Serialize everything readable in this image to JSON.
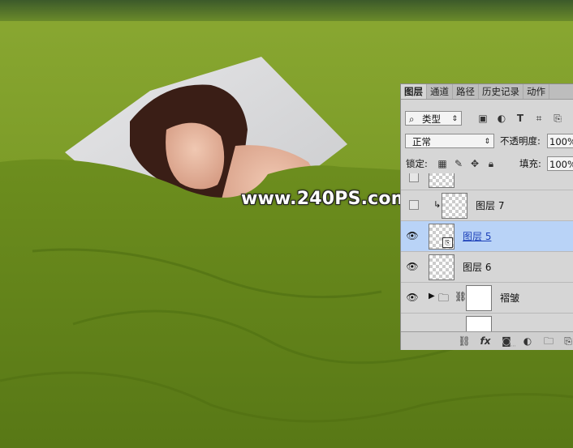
{
  "watermark": "www.240PS.com",
  "panel": {
    "tabs": [
      "图层",
      "通道",
      "路径",
      "历史记录",
      "动作"
    ],
    "filter": {
      "icon": "search-icon",
      "label": "类型"
    },
    "blend_mode": "正常",
    "opacity_label": "不透明度:",
    "opacity_value": "100%",
    "lock_label": "锁定:",
    "fill_label": "填充:",
    "fill_value": "100%",
    "layers": [
      {
        "name": "图层 7",
        "visible": false,
        "clipped": true,
        "selected": false
      },
      {
        "name": "图层 5",
        "visible": true,
        "smart_object": true,
        "selected": true
      },
      {
        "name": "图层 6",
        "visible": true,
        "selected": false
      },
      {
        "name": "褶皱",
        "visible": true,
        "group": true,
        "mask": true,
        "selected": false
      }
    ]
  },
  "colors": {
    "panel_bg": "#d6d6d6",
    "selection": "#b9d3f7",
    "grass": "#6f8f1f"
  }
}
